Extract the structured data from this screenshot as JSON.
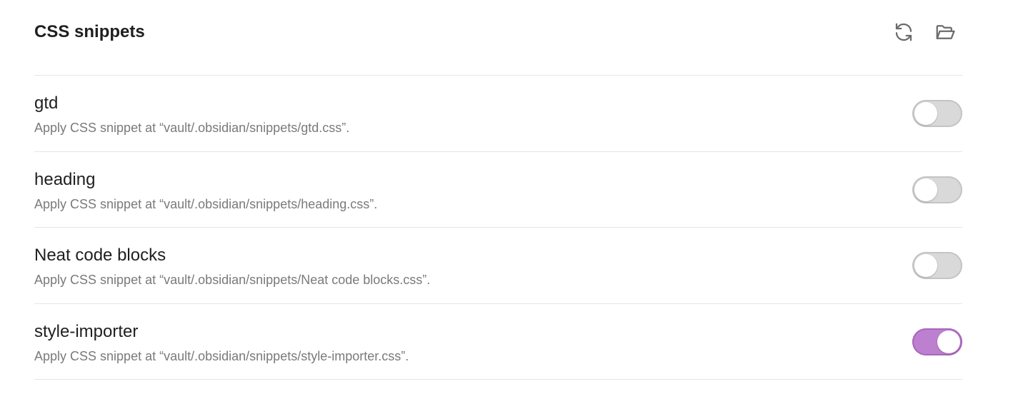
{
  "section": {
    "title": "CSS snippets",
    "reload_icon": "reload-icon",
    "open_folder_icon": "open-folder-icon"
  },
  "snippets": [
    {
      "name": "gtd",
      "description": "Apply CSS snippet at “vault/.obsidian/snippets/gtd.css”.",
      "enabled": false
    },
    {
      "name": "heading",
      "description": "Apply CSS snippet at “vault/.obsidian/snippets/heading.css”.",
      "enabled": false
    },
    {
      "name": "Neat code blocks",
      "description": "Apply CSS snippet at “vault/.obsidian/snippets/Neat code blocks.css”.",
      "enabled": false
    },
    {
      "name": "style-importer",
      "description": "Apply CSS snippet at “vault/.obsidian/snippets/style-importer.css”.",
      "enabled": true
    }
  ],
  "colors": {
    "accent": "#bd7fcf",
    "toggle_off": "#d9d9d9"
  }
}
